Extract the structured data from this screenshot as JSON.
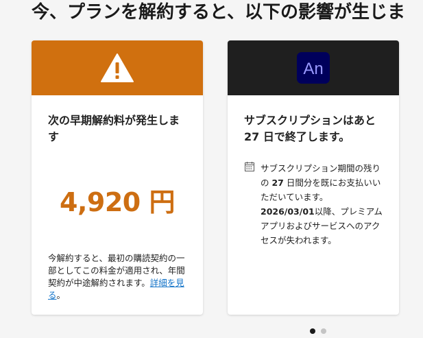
{
  "page": {
    "title": "今、プランを解約すると、以下の影響が生じま"
  },
  "cards": [
    {
      "icon": "warning-icon",
      "header_color": "#d0700f",
      "heading": "次の早期解約料が発生します",
      "amount": "4,920 円",
      "note_text": "今解約すると、最初の購読契約の一部としてこの料金が適用され、年間契約が中途解約されます。",
      "note_link": "詳細を見る",
      "note_end": "。"
    },
    {
      "icon": "animate-app-icon",
      "app_icon_label": "An",
      "header_color": "#1f1f1f",
      "heading": "サブスクリプションはあと 27 日で終了します。",
      "info_part1": "サブスクリプション期間の残りの ",
      "info_days": "27",
      "info_part2": " 日間分を既にお支払いいただいています。",
      "info_date": "2026/03/01",
      "info_part3": "以降、プレミアムアプリおよびサービスへのアクセスが失われます。"
    }
  ],
  "pagination": {
    "count": 2,
    "active_index": 0
  },
  "colors": {
    "accent_orange": "#cd6e12",
    "link_blue": "#1273c8",
    "animate_icon_bg": "#00005b",
    "animate_icon_text": "#9999ff"
  }
}
